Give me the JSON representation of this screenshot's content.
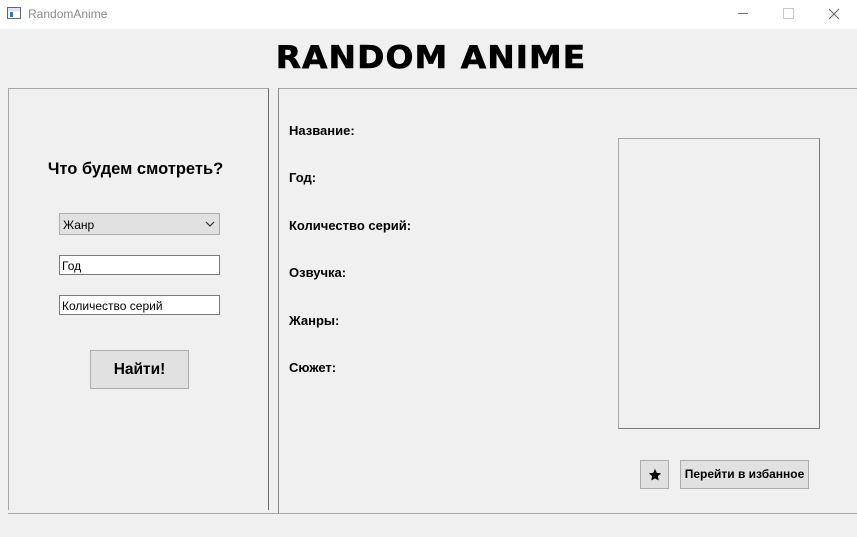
{
  "window": {
    "title": "RandomAnime",
    "icon": "window-app-icon"
  },
  "header": {
    "title": "RANDOM ANIME"
  },
  "search_panel": {
    "question": "Что будем смотреть?",
    "genre_select": {
      "value": "Жанр",
      "icon": "chevron-down-icon"
    },
    "year_field": {
      "value": "Год"
    },
    "episodes_field": {
      "value": "Количество серий"
    },
    "find_button": "Найти!"
  },
  "details_panel": {
    "labels": {
      "name": "Название:",
      "year": "Год:",
      "episodes": "Количество серий:",
      "voiceover": "Озвучка:",
      "genres": "Жанры:",
      "plot": "Сюжет:"
    },
    "favorite_button_icon": "star-icon",
    "goto_favorites_button": "Перейти в избанное"
  }
}
